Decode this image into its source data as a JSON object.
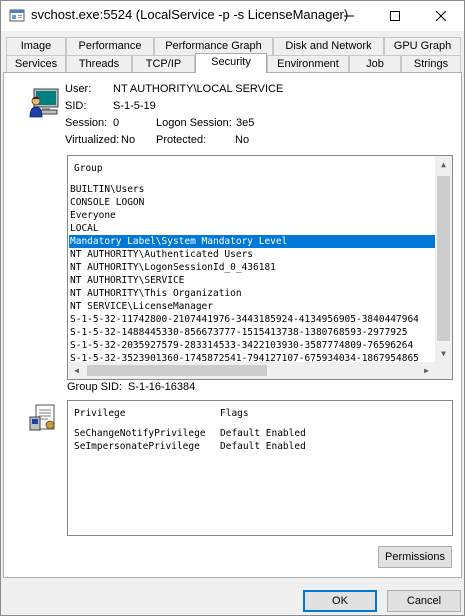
{
  "window": {
    "title": "svchost.exe:5524 (LocalService -p -s LicenseManager) Properties"
  },
  "tabs_row1": [
    "Image",
    "Performance",
    "Performance Graph",
    "Disk and Network",
    "GPU Graph"
  ],
  "tabs_row2": [
    "Services",
    "Threads",
    "TCP/IP",
    "Security",
    "Environment",
    "Job",
    "Strings"
  ],
  "active_tab": "Security",
  "info": {
    "user_label": "User:",
    "user_value": "NT AUTHORITY\\LOCAL SERVICE",
    "sid_label": "SID:",
    "sid_value": "S-1-5-19",
    "session_label": "Session:",
    "session_value": "0",
    "logon_session_label": "Logon Session:",
    "logon_session_value": "3e5",
    "virtualized_label": "Virtualized:",
    "virtualized_value": "No",
    "protected_label": "Protected:",
    "protected_value": "No"
  },
  "groups": {
    "header": "Group",
    "items": [
      "BUILTIN\\Users",
      "CONSOLE LOGON",
      "Everyone",
      "LOCAL",
      "Mandatory Label\\System Mandatory Level",
      "NT AUTHORITY\\Authenticated Users",
      "NT AUTHORITY\\LogonSessionId_0_436181",
      "NT AUTHORITY\\SERVICE",
      "NT AUTHORITY\\This Organization",
      "NT SERVICE\\LicenseManager",
      "S-1-5-32-11742800-2107441976-3443185924-4134956905-3840447964",
      "S-1-5-32-1488445330-856673777-1515413738-1380768593-2977925",
      "S-1-5-32-2035927579-283314533-3422103930-3587774809-76596264",
      "S-1-5-32-3523901360-1745872541-794127107-675934034-1867954865"
    ],
    "selected_index": 4
  },
  "group_sid": {
    "label": "Group SID:",
    "value": "S-1-16-16384"
  },
  "privileges": {
    "col_privilege": "Privilege",
    "col_flags": "Flags",
    "rows": [
      {
        "name": "SeChangeNotifyPrivilege",
        "flags": "Default Enabled"
      },
      {
        "name": "SeImpersonatePrivilege",
        "flags": "Default Enabled"
      }
    ]
  },
  "buttons": {
    "permissions": "Permissions",
    "ok": "OK",
    "cancel": "Cancel"
  },
  "colors": {
    "selection": "#0078d7",
    "accent": "#0078d7"
  }
}
